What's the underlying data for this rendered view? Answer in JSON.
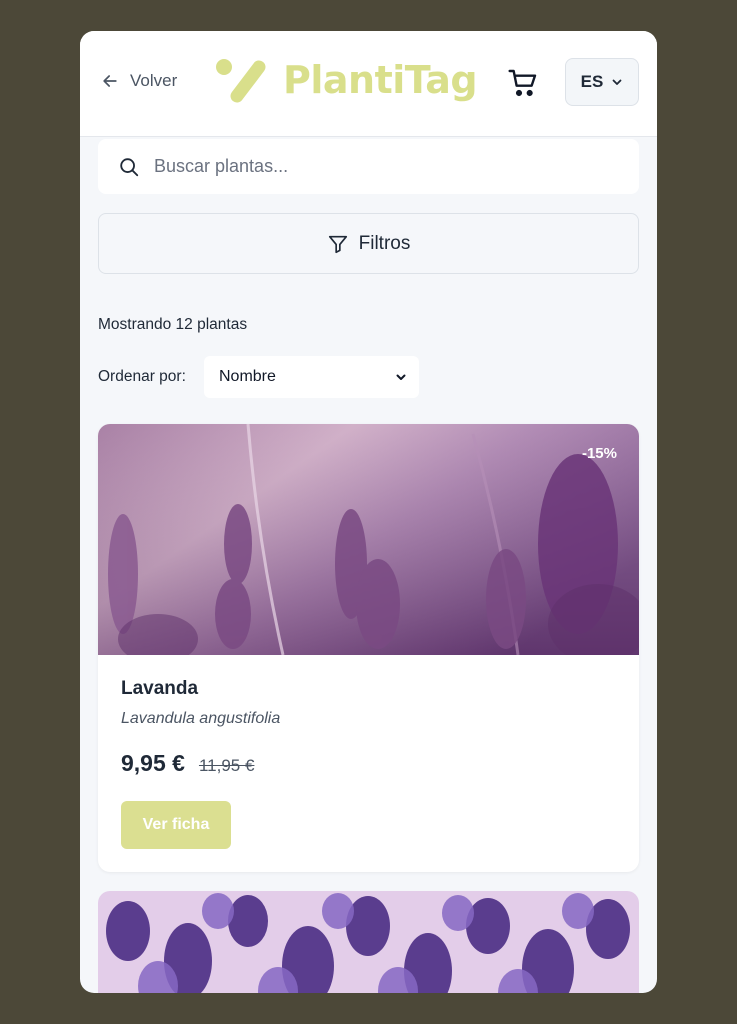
{
  "header": {
    "back_label": "Volver",
    "logo_text": "PlantiTag",
    "language": "ES"
  },
  "search": {
    "placeholder": "Buscar plantas..."
  },
  "filters": {
    "label": "Filtros"
  },
  "results": {
    "count_text": "Mostrando 12 plantas",
    "sort_label": "Ordenar por:",
    "sort_value": "Nombre"
  },
  "products": [
    {
      "name": "Lavanda",
      "scientific_name": "Lavandula angustifolia",
      "price": "9,95 €",
      "old_price": "11,95 €",
      "discount": "-15%",
      "button_label": "Ver ficha"
    }
  ],
  "colors": {
    "brand": "#d9df8b",
    "button": "#dbdf91",
    "background": "#4c4838"
  }
}
